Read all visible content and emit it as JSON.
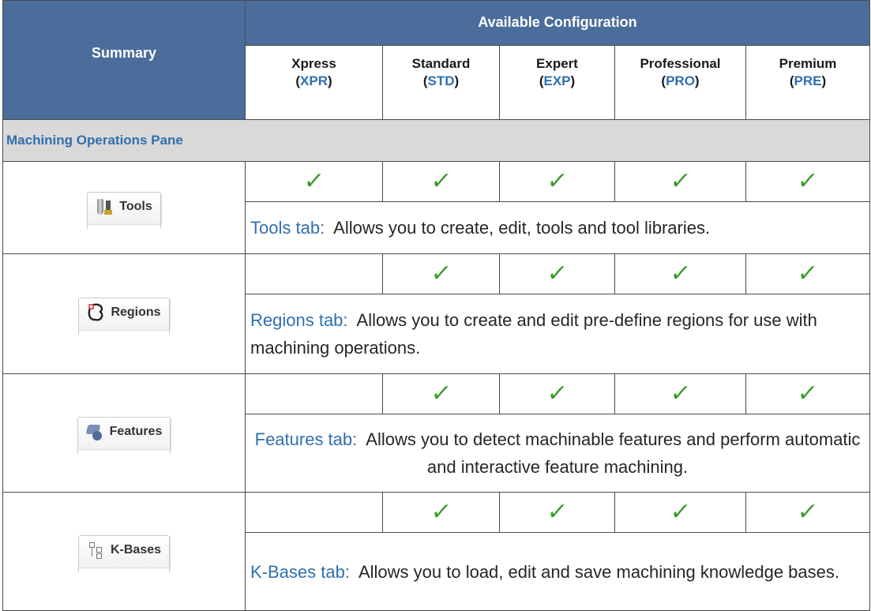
{
  "header": {
    "summary": "Summary",
    "available": "Available Configuration",
    "configs": [
      {
        "name": "Xpress",
        "code": "XPR"
      },
      {
        "name": "Standard",
        "code": "STD"
      },
      {
        "name": "Expert",
        "code": "EXP"
      },
      {
        "name": "Professional",
        "code": "PRO"
      },
      {
        "name": "Premium",
        "code": "PRE"
      }
    ]
  },
  "section": {
    "title": "Machining Operations Pane"
  },
  "check_glyph": "✓",
  "rows": [
    {
      "tab_label": "Tools",
      "icon": "tools-icon",
      "checks": [
        true,
        true,
        true,
        true,
        true
      ],
      "desc_name": "Tools tab:",
      "desc_text": "  Allows you to create, edit, tools and tool libraries."
    },
    {
      "tab_label": "Regions",
      "icon": "regions-icon",
      "checks": [
        false,
        true,
        true,
        true,
        true
      ],
      "desc_name": "Regions tab:",
      "desc_text": "  Allows you to create and edit pre-define regions for use with machining operations."
    },
    {
      "tab_label": "Features",
      "icon": "features-icon",
      "checks": [
        false,
        true,
        true,
        true,
        true
      ],
      "desc_name": "Features tab:",
      "desc_text": "  Allows you to detect machinable features and perform automatic and interactive feature machining."
    },
    {
      "tab_label": "K-Bases",
      "icon": "kbases-icon",
      "checks": [
        false,
        true,
        true,
        true,
        true
      ],
      "desc_name": "K-Bases tab:",
      "desc_text": "  Allows you to load, edit and save machining knowledge bases."
    }
  ],
  "colors": {
    "header_bg": "#4a6d9b",
    "accent_blue": "#2f6fb0",
    "check_green": "#3a9a2a",
    "section_bg": "#d9d9d9"
  }
}
